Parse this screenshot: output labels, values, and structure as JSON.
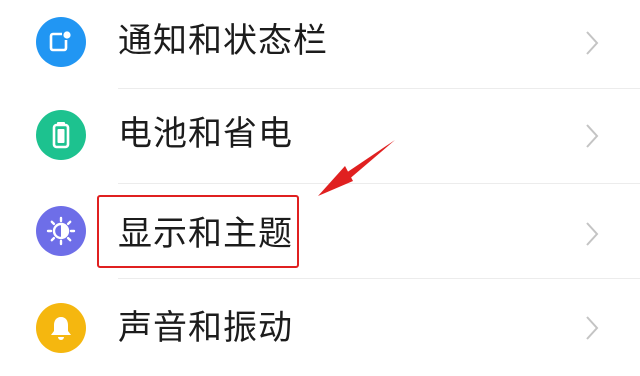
{
  "settings": {
    "items": [
      {
        "label": "通知和状态栏",
        "icon": "notification-icon",
        "icon_color": "#2196F3"
      },
      {
        "label": "电池和省电",
        "icon": "battery-icon",
        "icon_color": "#1DC28F"
      },
      {
        "label": "显示和主题",
        "icon": "brightness-icon",
        "icon_color": "#6E6EE8"
      },
      {
        "label": "声音和振动",
        "icon": "bell-icon",
        "icon_color": "#F5B70F"
      }
    ]
  },
  "annotation": {
    "highlight_color": "#E02020",
    "highlighted_item": "显示和主题"
  }
}
